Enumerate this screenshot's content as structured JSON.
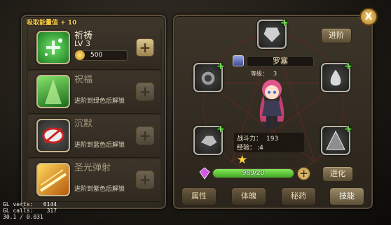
{
  "header": {
    "absorb_label": "吸取能量值 + 10"
  },
  "skills": [
    {
      "name": "祈祷",
      "level": "LV 3",
      "cost": "500",
      "desc": "",
      "plus": "+"
    },
    {
      "name": "祝福",
      "level": "",
      "cost": "",
      "desc": "进阶到绿色后解锁",
      "plus": "+"
    },
    {
      "name": "沉默",
      "level": "",
      "cost": "",
      "desc": "进阶到蓝色后解锁",
      "plus": "+"
    },
    {
      "name": "圣光弹射",
      "level": "",
      "cost": "",
      "desc": "进阶到紫色后解锁",
      "plus": "+"
    }
  ],
  "hero": {
    "name": "罗塞",
    "level_label": "等级：",
    "level": "3",
    "power_label": "战斗力：",
    "power": "193",
    "exp_label": "经验：",
    "exp": "4",
    "stars_filled": 1,
    "stars_total": 5,
    "energy_text": "989/20",
    "energy_fraction": 1.0
  },
  "buttons": {
    "advance": "进阶",
    "evolve": "进化",
    "close": "X",
    "plus": "+"
  },
  "tabs": [
    {
      "label": "属性",
      "active": false
    },
    {
      "label": "体魄",
      "active": false
    },
    {
      "label": "秘药",
      "active": false
    },
    {
      "label": "技能",
      "active": true
    }
  ],
  "debug": {
    "verts": "GL verts:   6144",
    "calls": "GL calls:    317",
    "fps": "30.1 / 0.031"
  },
  "colors": {
    "accent_gold": "#ffd34a",
    "energy_green": "#5fd23a",
    "plus_green": "#6cf04a"
  }
}
